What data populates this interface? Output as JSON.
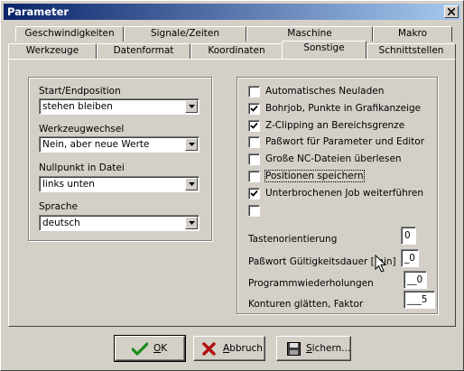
{
  "window": {
    "title": "Parameter"
  },
  "tabs": {
    "row1": [
      {
        "label": "Geschwindigkeiten"
      },
      {
        "label": "Signale/Zeiten"
      },
      {
        "label": "Maschine"
      },
      {
        "label": "Makro"
      }
    ],
    "row2": [
      {
        "label": "Werkzeuge"
      },
      {
        "label": "Datenformat"
      },
      {
        "label": "Koordinaten"
      },
      {
        "label": "Sonstige",
        "active": true
      },
      {
        "label": "Schnittstellen"
      }
    ]
  },
  "left": {
    "start_end": {
      "label": "Start/Endposition",
      "value": "stehen bleiben"
    },
    "tool_change": {
      "label": "Werkzeugwechsel",
      "value": "Nein, aber neue Werte"
    },
    "zero_point": {
      "label": "Nullpunkt in Datei",
      "value": "links unten"
    },
    "language": {
      "label": "Sprache",
      "value": "deutsch"
    }
  },
  "options": [
    {
      "label": "Automatisches Neuladen",
      "checked": false
    },
    {
      "label": "Bohrjob, Punkte in Grafikanzeige",
      "checked": true
    },
    {
      "label": "Z-Clipping an Bereichsgrenze",
      "checked": true
    },
    {
      "label": "Paßwort für Parameter und Editor",
      "checked": false
    },
    {
      "label": "Große NC-Dateien überlesen",
      "checked": false
    },
    {
      "label": "Positionen speichern",
      "checked": false
    },
    {
      "label": "Unterbrochenen Job weiterführen",
      "checked": true
    },
    {
      "label": "",
      "checked": false
    }
  ],
  "fields": {
    "key_orientation": {
      "label": "Tastenorientierung",
      "value": "0"
    },
    "password_validity": {
      "label": "Paßwort Gültigkeitsdauer [min]",
      "value": "_0"
    },
    "program_repeats": {
      "label": "Programmwiederholungen",
      "value": "__0"
    },
    "smooth_contours": {
      "label": "Konturen glätten, Faktor",
      "value": "___5"
    }
  },
  "buttons": {
    "ok": {
      "label_ul": "O",
      "label_rest": "K",
      "icon": "check-icon"
    },
    "cancel": {
      "label_ul": "A",
      "label_rest": "bbruch",
      "icon": "x-icon"
    },
    "save": {
      "label_ul": "S",
      "label_rest": "ichern...",
      "icon": "floppy-disk-icon"
    }
  }
}
